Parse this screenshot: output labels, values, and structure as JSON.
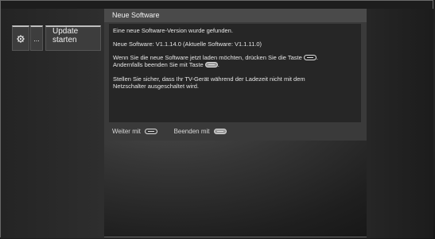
{
  "menu": {
    "settings_icon": "gear-icon",
    "more_label": "...",
    "update_line1": "Update",
    "update_line2": "starten"
  },
  "dialog": {
    "title": "Neue Software",
    "line1": "Eine neue Software-Version wurde gefunden.",
    "line2": "Neue Software:  V1.1.14.0  (Aktuelle Software:  V1.1.11.0)",
    "line3a": "Wenn Sie die neue Software jetzt laden möchten, drücken Sie die Taste",
    "line3b": "Andernfalls beenden Sie mit Taste",
    "line4a": "Stellen Sie sicher, dass Ihr TV-Gerät während der Ladezeit nicht mit dem",
    "line4b": "Netzschalter ausgeschaltet wird.",
    "footer_continue": "Weiter mit",
    "footer_exit": "Beenden mit"
  },
  "colors": {
    "dialog_bg": "#3a3a3a",
    "dialog_title_bg": "#4a4a4a",
    "dialog_body_bg": "#262626"
  }
}
